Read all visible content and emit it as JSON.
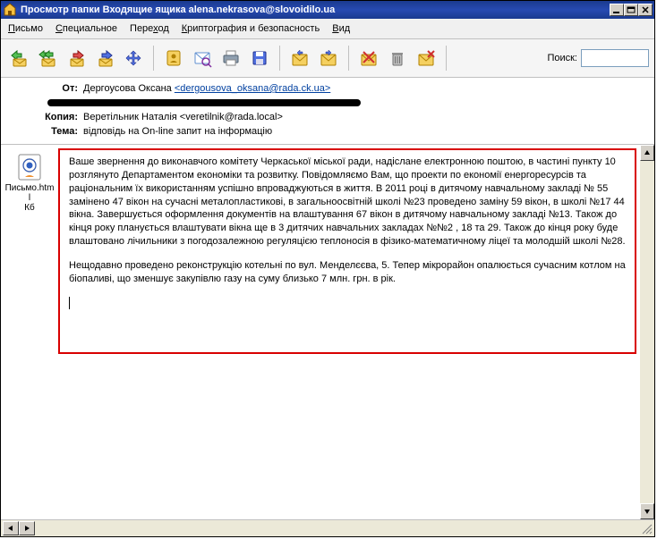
{
  "window": {
    "title": "Просмотр папки Входящие ящика alena.nekrasova@slovoidilo.ua"
  },
  "menus": [
    {
      "pre": "",
      "mn": "П",
      "post": "исьмо"
    },
    {
      "pre": "",
      "mn": "С",
      "post": "пециальное"
    },
    {
      "pre": "Пере",
      "mn": "х",
      "post": "од"
    },
    {
      "pre": "",
      "mn": "К",
      "post": "риптография и безопасность"
    },
    {
      "pre": "",
      "mn": "В",
      "post": "ид"
    }
  ],
  "toolbar": {
    "search_label": "Поиск:",
    "search_value": ""
  },
  "headers": {
    "from_label": "От:",
    "from_name": "Дергоусова Оксана ",
    "from_addr": "<dergousova_oksana@rada.ck.ua>",
    "copy_label": "Копия:",
    "copy_value": "Веретільник Наталія <veretilnik@rada.local>",
    "subject_label": "Тема:",
    "subject_value": "відповідь на On-line запит на інформацію"
  },
  "attachment": {
    "filename": "Письмо.html",
    "size": "Кб"
  },
  "body": {
    "p1": "Ваше звернення до виконавчого комітету Черкаської міської ради, надіслане електронною поштою, в частині пункту 10 розглянуто Департаментом економіки та розвитку. Повідомляємо Вам, що проекти по економії енергоресурсів та раціональним їх використанням успішно впроваджуються в життя. В 2011 році в дитячому навчальному закладі № 55  замінено 47 вікон на сучасні металопластикові, в загальноосвітній школі №23  проведено заміну 59 вікон, в школі №17  44  вікна. Завершується оформлення документів на влаштування 67 вікон в дитячому навчальному закладі №13.  Також до кінця року планується влаштувати вікна ще в 3 дитячих навчальних закладах №№2 ,  18  та 29. Також до кінця року буде влаштовано лічильники з погодозалежною регуляцією теплоносія в фізико-математичному ліцеї та молодшій школі №28.",
    "p2": "Нещодавно проведено реконструкцію котельні по вул. Менделєєва, 5. Тепер мікрорайон опалюється сучасним котлом на біопаливі, що зменшує закупівлю газу на суму близько 7 млн. грн. в рік."
  }
}
